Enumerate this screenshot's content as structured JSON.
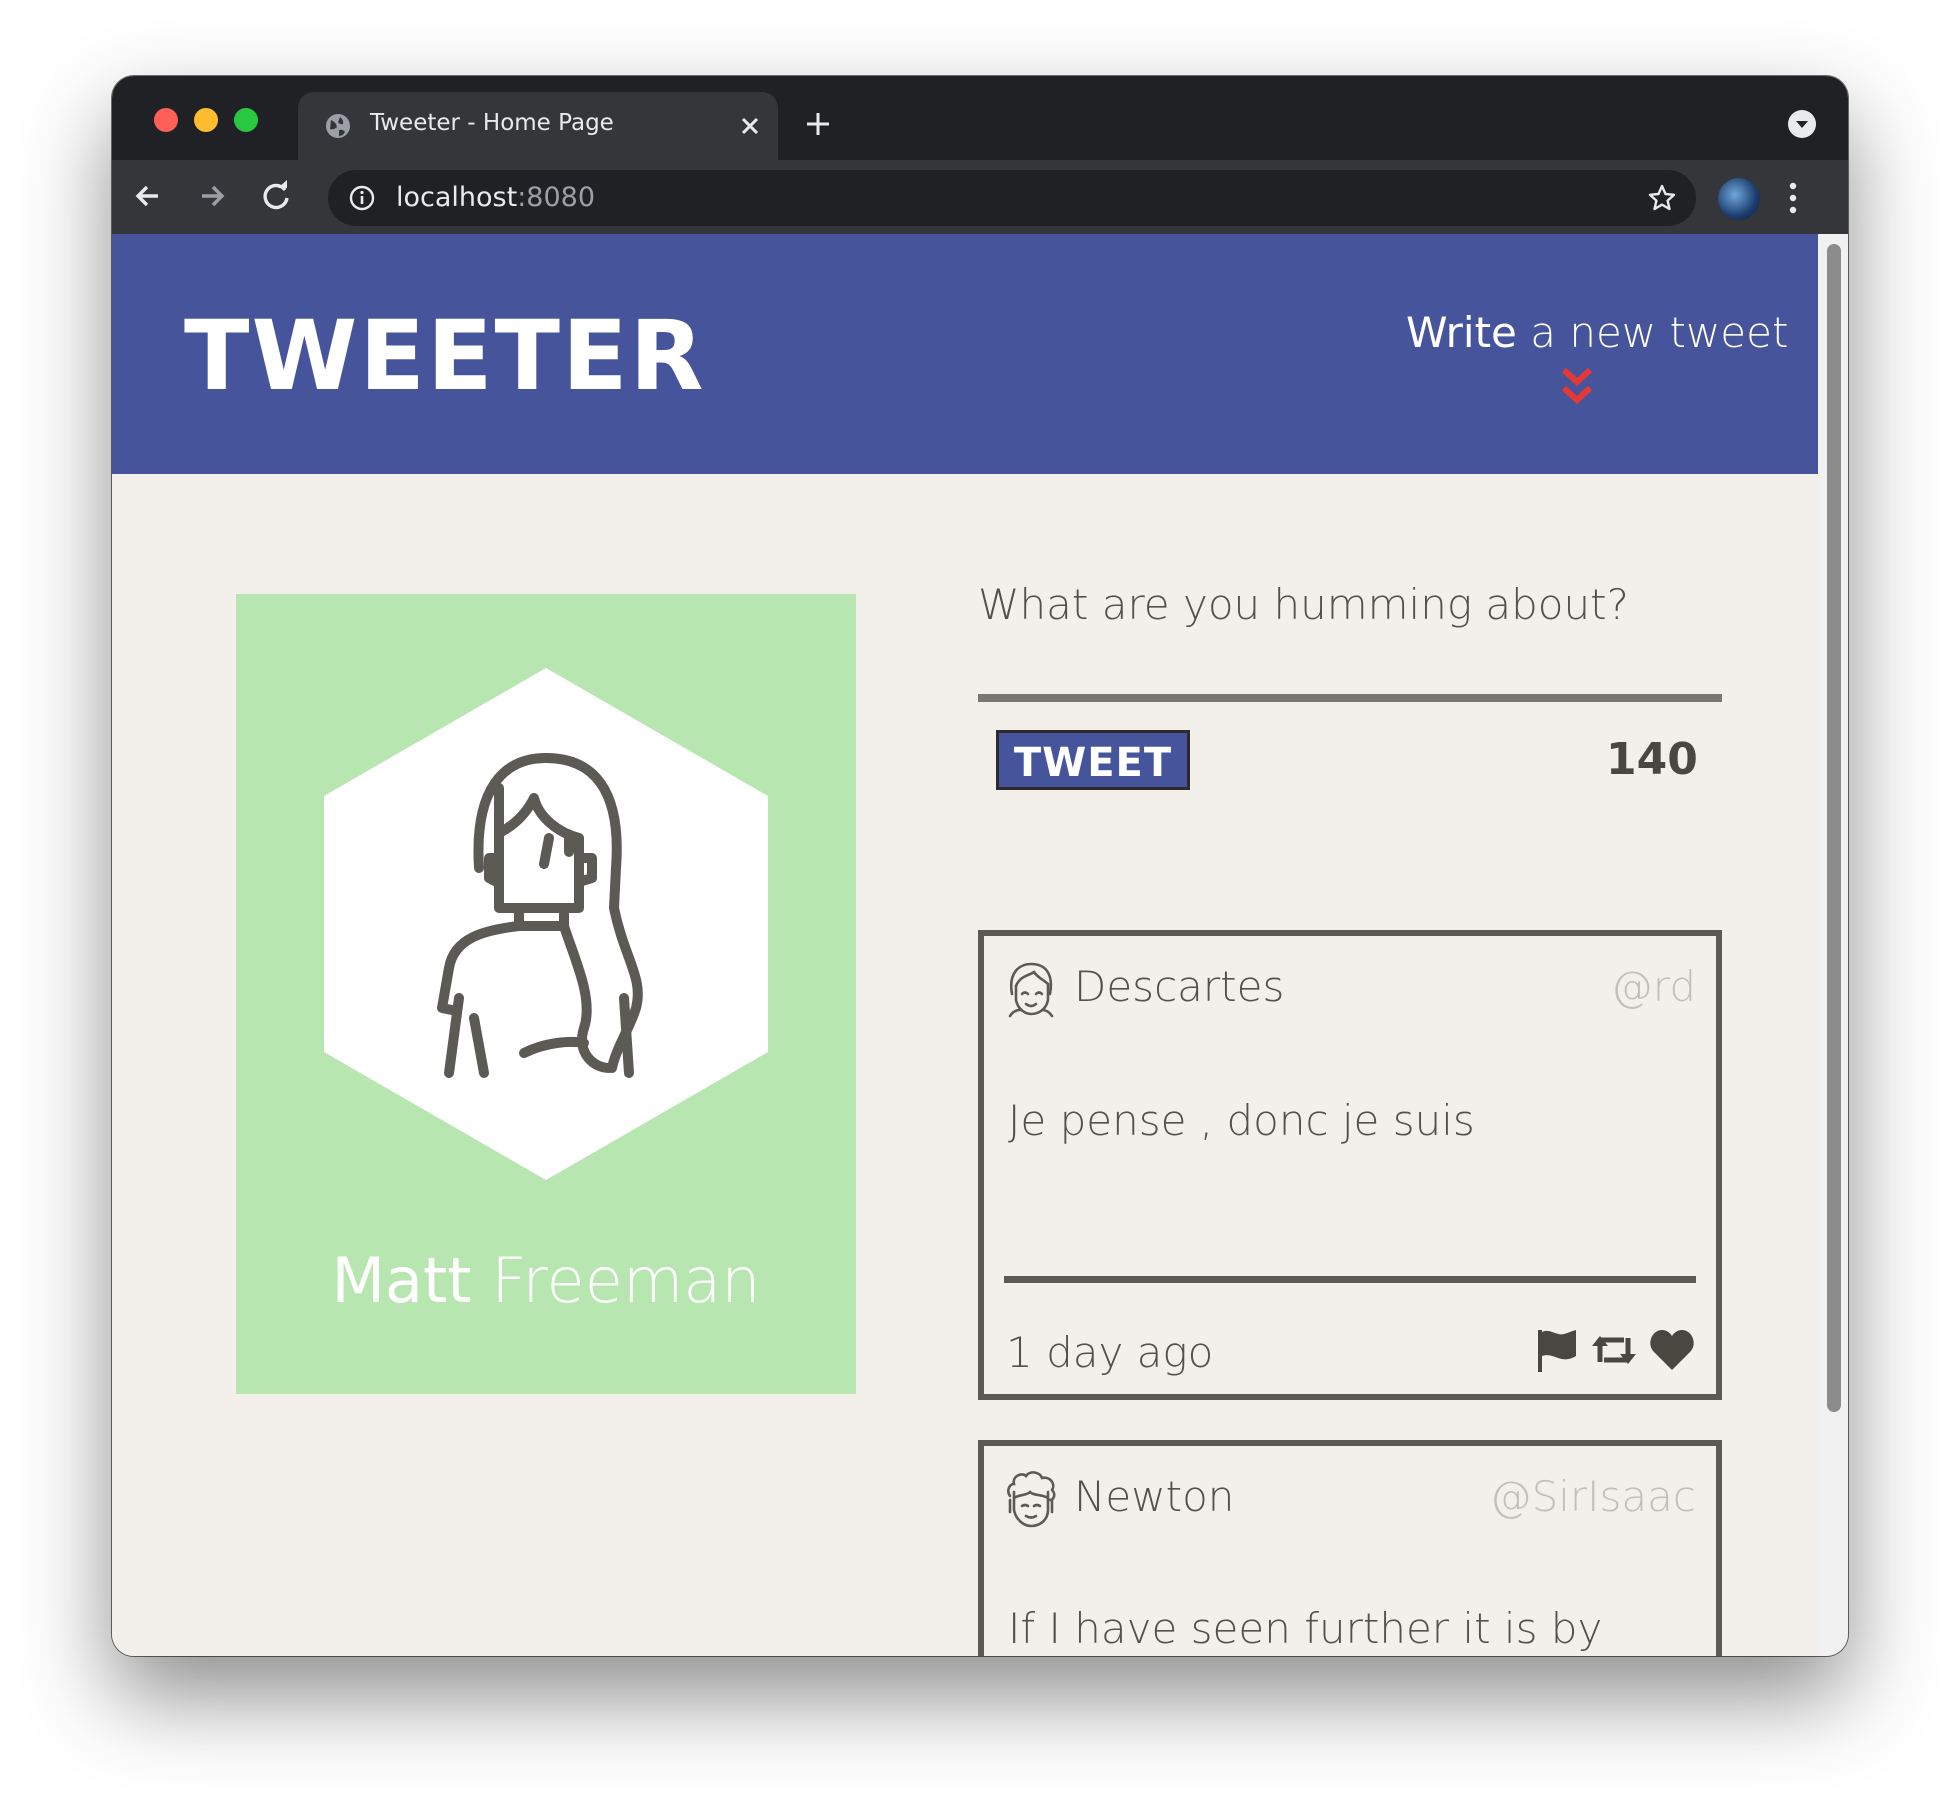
{
  "browser": {
    "tab_title": "Tweeter - Home Page",
    "url_host": "localhost",
    "url_port": ":8080"
  },
  "nav": {
    "brand": "TWEETER",
    "compose_link_strong": "Write",
    "compose_link_rest": " a new tweet"
  },
  "profile": {
    "first_name": "Matt",
    "last_name": " Freeman"
  },
  "compose": {
    "prompt": "What are you humming about?",
    "button_label": "TWEET",
    "counter": "140"
  },
  "tweets": [
    {
      "name": "Descartes",
      "handle": "@rd",
      "content": "Je pense , donc je suis",
      "time": "1 day ago",
      "actions": [
        "flag-icon",
        "retweet-icon",
        "heart-icon"
      ]
    },
    {
      "name": "Newton",
      "handle": "@SirIsaac",
      "content": "If I have seen further it is by"
    }
  ],
  "colors": {
    "nav_bg": "#46559b",
    "page_bg": "#f3f0ec",
    "profile_bg": "#b8e6b0",
    "text": "#545149",
    "chevron": "#e53935"
  }
}
